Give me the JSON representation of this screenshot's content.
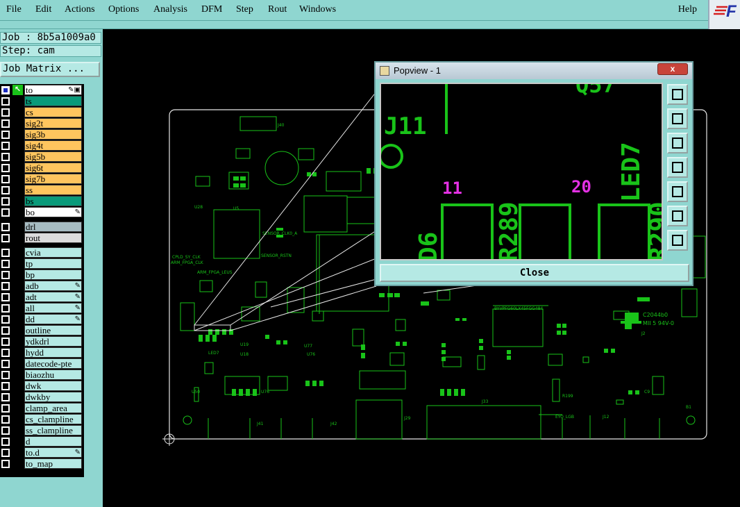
{
  "menubar": {
    "items": [
      "File",
      "Edit",
      "Actions",
      "Options",
      "Analysis",
      "DFM",
      "Step",
      "Rout",
      "Windows"
    ],
    "help": "Help",
    "logo_text": "F"
  },
  "job": {
    "job_line": "Job : 8b5a1009a0",
    "step_line": "Step: cam",
    "matrix_button": "Job Matrix ..."
  },
  "layers": [
    {
      "name": "to",
      "color": "white",
      "checked": true,
      "mark": "✎▣"
    },
    {
      "name": "ts",
      "color": "solder",
      "checked": false,
      "mark": ""
    },
    {
      "name": "cs",
      "color": "sig",
      "checked": false,
      "mark": ""
    },
    {
      "name": "sig2t",
      "color": "sig",
      "checked": false,
      "mark": ""
    },
    {
      "name": "sig3b",
      "color": "sig",
      "checked": false,
      "mark": ""
    },
    {
      "name": "sig4t",
      "color": "sig",
      "checked": false,
      "mark": ""
    },
    {
      "name": "sig5b",
      "color": "sig",
      "checked": false,
      "mark": ""
    },
    {
      "name": "sig6t",
      "color": "sig",
      "checked": false,
      "mark": ""
    },
    {
      "name": "sig7b",
      "color": "sig",
      "checked": false,
      "mark": ""
    },
    {
      "name": "ss",
      "color": "sig",
      "checked": false,
      "mark": ""
    },
    {
      "name": "bs",
      "color": "solder",
      "checked": false,
      "mark": ""
    },
    {
      "name": "bo",
      "color": "white",
      "checked": false,
      "mark": "✎"
    },
    {
      "name": "drl",
      "color": "drill",
      "checked": false,
      "mark": ""
    },
    {
      "name": "rout",
      "color": "rout",
      "checked": false,
      "mark": ""
    },
    {
      "name": "cvia",
      "color": "board",
      "checked": false,
      "mark": ""
    },
    {
      "name": "tp",
      "color": "board",
      "checked": false,
      "mark": ""
    },
    {
      "name": "bp",
      "color": "board",
      "checked": false,
      "mark": ""
    },
    {
      "name": "adb",
      "color": "board",
      "checked": false,
      "mark": "✎"
    },
    {
      "name": "adt",
      "color": "board",
      "checked": false,
      "mark": "✎"
    },
    {
      "name": "all",
      "color": "board",
      "checked": false,
      "mark": "✎"
    },
    {
      "name": "dd",
      "color": "board",
      "checked": false,
      "mark": "✎"
    },
    {
      "name": "outline",
      "color": "board",
      "checked": false,
      "mark": ""
    },
    {
      "name": "ydkdrl",
      "color": "board",
      "checked": false,
      "mark": ""
    },
    {
      "name": "hydd",
      "color": "board",
      "checked": false,
      "mark": ""
    },
    {
      "name": "datecode-pte",
      "color": "board",
      "checked": false,
      "mark": ""
    },
    {
      "name": "biaozhu",
      "color": "board",
      "checked": false,
      "mark": ""
    },
    {
      "name": "dwk",
      "color": "board",
      "checked": false,
      "mark": ""
    },
    {
      "name": "dwkby",
      "color": "board",
      "checked": false,
      "mark": ""
    },
    {
      "name": "clamp_area",
      "color": "board",
      "checked": false,
      "mark": ""
    },
    {
      "name": "cs_clampline",
      "color": "board",
      "checked": false,
      "mark": ""
    },
    {
      "name": "ss_clampline",
      "color": "board",
      "checked": false,
      "mark": ""
    },
    {
      "name": "d",
      "color": "board",
      "checked": false,
      "mark": ""
    },
    {
      "name": "to.d",
      "color": "board",
      "checked": false,
      "mark": "✎"
    },
    {
      "name": "to_map",
      "color": "board",
      "checked": false,
      "mark": ""
    }
  ],
  "popview": {
    "title": "Popview - 1",
    "close_x": "x",
    "close_button": "Close",
    "labels": {
      "j11": "J11",
      "led7": "LED7",
      "r289": "R289",
      "r290": "R290",
      "d6": "D6",
      "n11": "11",
      "n20": "20",
      "q57": "Q57"
    },
    "tools": [
      "zoom-home-icon",
      "pan-up-icon",
      "pan-down-icon",
      "pan-left-icon",
      "pan-right-icon",
      "zoom-out-icon",
      "zoom-in-icon"
    ]
  },
  "board": {
    "labels": [
      "J40",
      "J41",
      "J42",
      "J29",
      "J33",
      "J12",
      "U28",
      "U1",
      "U8",
      "U10",
      "U77",
      "U50",
      "U76",
      "LED7",
      "SENSOR_CLK0_A",
      "SENSOR_RSTN",
      "C2044b0",
      "MII 5 94V-0",
      "TD",
      "Q57"
    ]
  },
  "colors": {
    "menu_bg": "#8fd6d0",
    "pcb_green": "#19c319",
    "board_outline": "#e6e6e6",
    "magenta": "#e431e4"
  }
}
